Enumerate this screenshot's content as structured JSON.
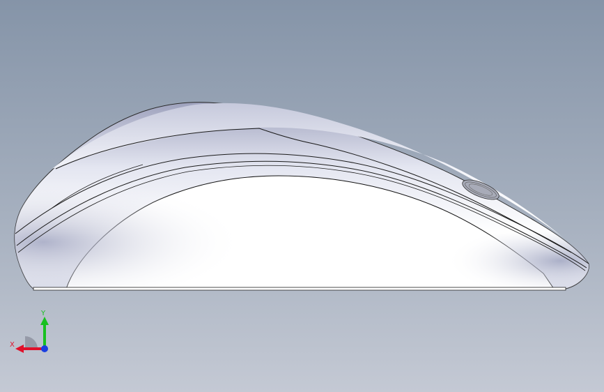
{
  "triad": {
    "x_label": "X",
    "y_label": "Y",
    "x_color": "#e0102a",
    "y_color": "#18c020",
    "z_color": "#1a3ee0"
  },
  "model": {
    "body_color": "#ffffff",
    "shadow_color": "#a9aec6",
    "outline_color": "#000000",
    "wheel_icon": "scroll-wheel-icon"
  }
}
